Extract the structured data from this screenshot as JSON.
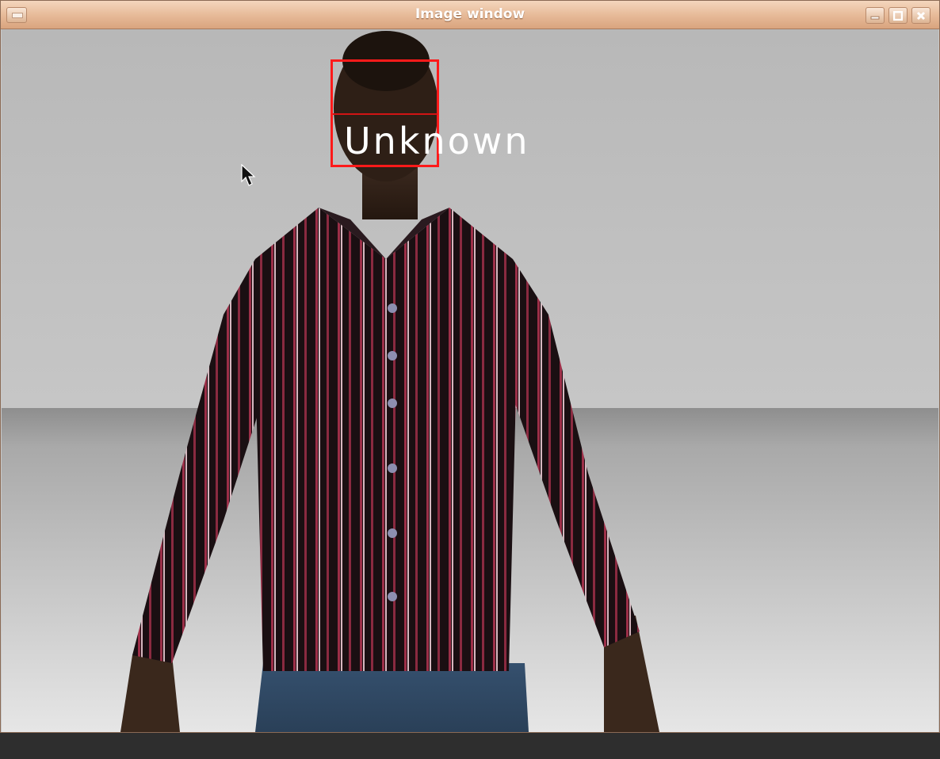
{
  "window": {
    "title": "Image window"
  },
  "detection": {
    "label": "Unknown",
    "box_color": "#ff1a1a"
  },
  "icons": {
    "menu": "window-menu-icon",
    "minimize": "minimize-icon",
    "maximize": "maximize-icon",
    "close": "close-icon",
    "cursor": "mouse-cursor-icon"
  }
}
